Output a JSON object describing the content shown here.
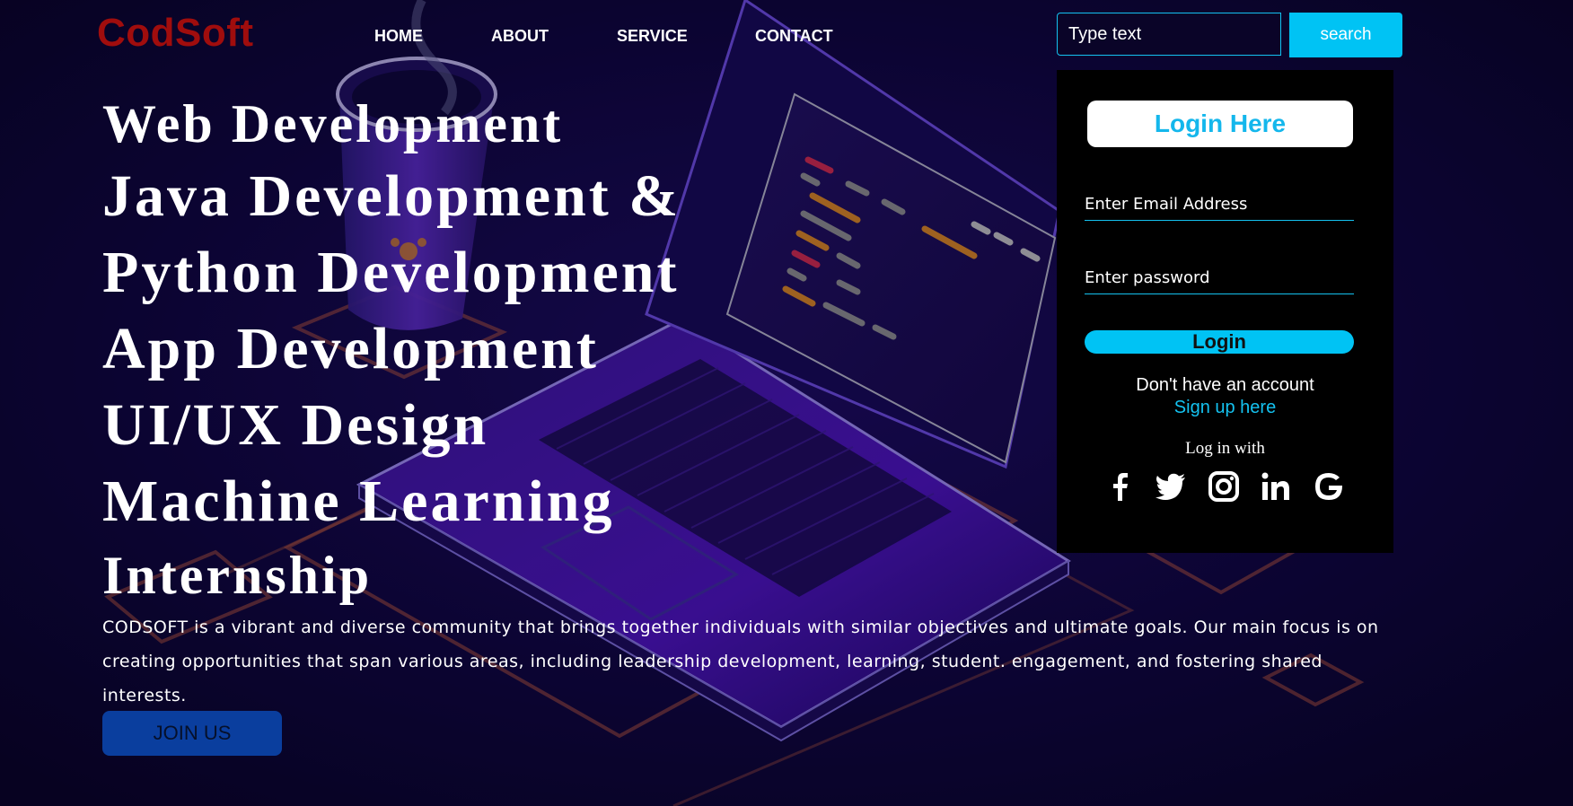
{
  "header": {
    "logo": "CodSoft",
    "nav": [
      "HOME",
      "ABOUT",
      "SERVICE",
      "CONTACT"
    ],
    "search": {
      "placeholder": "Type text",
      "button_label": "search"
    }
  },
  "login_panel": {
    "title": "Login Here",
    "email_placeholder": "Enter Email Address",
    "password_placeholder": "Enter password",
    "login_button": "Login",
    "no_account_text": "Don't have an account",
    "signup_link": "Sign up here",
    "login_with": "Log in with",
    "socials": [
      "facebook-icon",
      "twitter-icon",
      "instagram-icon",
      "linkedin-icon",
      "google-icon"
    ]
  },
  "hero": {
    "lines": [
      "Web Development",
      "Java Development &",
      "Python Development",
      "App Development",
      "UI/UX Design",
      "Machine Learning",
      "Internship"
    ],
    "description": "CODSOFT is a vibrant and diverse community that brings together individuals with similar objectives and ultimate goals. Our main focus is on creating opportunities that span various areas, including leadership development, learning, student. engagement, and fostering shared interests.",
    "join_button": "JOIN US"
  },
  "colors": {
    "background": "#0b0430",
    "accent": "#00c3f4",
    "logo": "#a00d0d",
    "join_button": "#0a3e9e"
  }
}
